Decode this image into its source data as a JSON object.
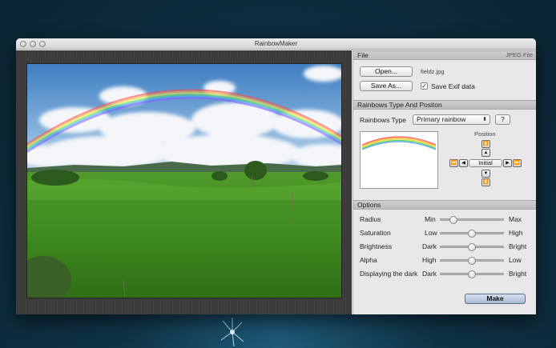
{
  "window": {
    "title": "RainbowMaker"
  },
  "file": {
    "header": "File",
    "header_right": "JPEG File",
    "open_label": "Open...",
    "filename": "fieldz.jpg",
    "save_as_label": "Save As...",
    "save_exif_label": "Save Exif data",
    "save_exif_checked": true
  },
  "rainbow": {
    "header": "Rainbows Type And Positon",
    "type_label": "Rainbows Type",
    "type_value": "Primary rainbow",
    "help_label": "?",
    "position_label": "Position",
    "initial_label": "Initial"
  },
  "options": {
    "header": "Options",
    "sliders": [
      {
        "name": "Radius",
        "min": "Min",
        "max": "Max",
        "value": 0.2
      },
      {
        "name": "Saturation",
        "min": "Low",
        "max": "High",
        "value": 0.5
      },
      {
        "name": "Brightness",
        "min": "Dark",
        "max": "Bright",
        "value": 0.5
      },
      {
        "name": "Alpha",
        "min": "High",
        "max": "Low",
        "value": 0.5
      },
      {
        "name": "Displaying the dark",
        "min": "Dark",
        "max": "Bright",
        "value": 0.5
      }
    ],
    "make_label": "Make"
  },
  "icons": {
    "close": "window-close-icon",
    "minimize": "window-minimize-icon",
    "zoom": "window-zoom-icon"
  }
}
